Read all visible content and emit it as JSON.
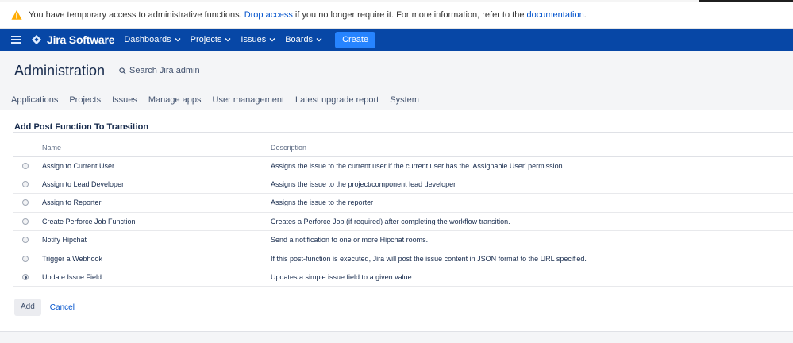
{
  "banner": {
    "text_before": "You have temporary access to administrative functions. ",
    "drop_link": "Drop access",
    "text_middle": " if you no longer require it. For more information, refer to the ",
    "doc_link": "documentation",
    "text_after": ".",
    "icon": "warning-icon"
  },
  "nav": {
    "menu_icon": "hamburger-icon",
    "product": "Jira Software",
    "items": [
      "Dashboards",
      "Projects",
      "Issues",
      "Boards"
    ],
    "create": "Create"
  },
  "admin": {
    "title": "Administration",
    "search_placeholder": "Search Jira admin",
    "tabs": [
      "Applications",
      "Projects",
      "Issues",
      "Manage apps",
      "User management",
      "Latest upgrade report",
      "System"
    ]
  },
  "form": {
    "title": "Add Post Function To Transition",
    "columns": {
      "name": "Name",
      "description": "Description"
    },
    "rows": [
      {
        "name": "Assign to Current User",
        "description": "Assigns the issue to the current user if the current user has the 'Assignable User' permission.",
        "selected": false
      },
      {
        "name": "Assign to Lead Developer",
        "description": "Assigns the issue to the project/component lead developer",
        "selected": false
      },
      {
        "name": "Assign to Reporter",
        "description": "Assigns the issue to the reporter",
        "selected": false
      },
      {
        "name": "Create Perforce Job Function",
        "description": "Creates a Perforce Job (if required) after completing the workflow transition.",
        "selected": false
      },
      {
        "name": "Notify Hipchat",
        "description": "Send a notification to one or more Hipchat rooms.",
        "selected": false
      },
      {
        "name": "Trigger a Webhook",
        "description": "If this post-function is executed, Jira will post the issue content in JSON format to the URL specified.",
        "selected": false
      },
      {
        "name": "Update Issue Field",
        "description": "Updates a simple issue field to a given value.",
        "selected": true
      }
    ],
    "add_label": "Add",
    "cancel_label": "Cancel"
  },
  "colors": {
    "nav_bg": "#0747a6",
    "create_bg": "#2684ff",
    "link": "#0052cc",
    "warning": "#ffab00"
  }
}
